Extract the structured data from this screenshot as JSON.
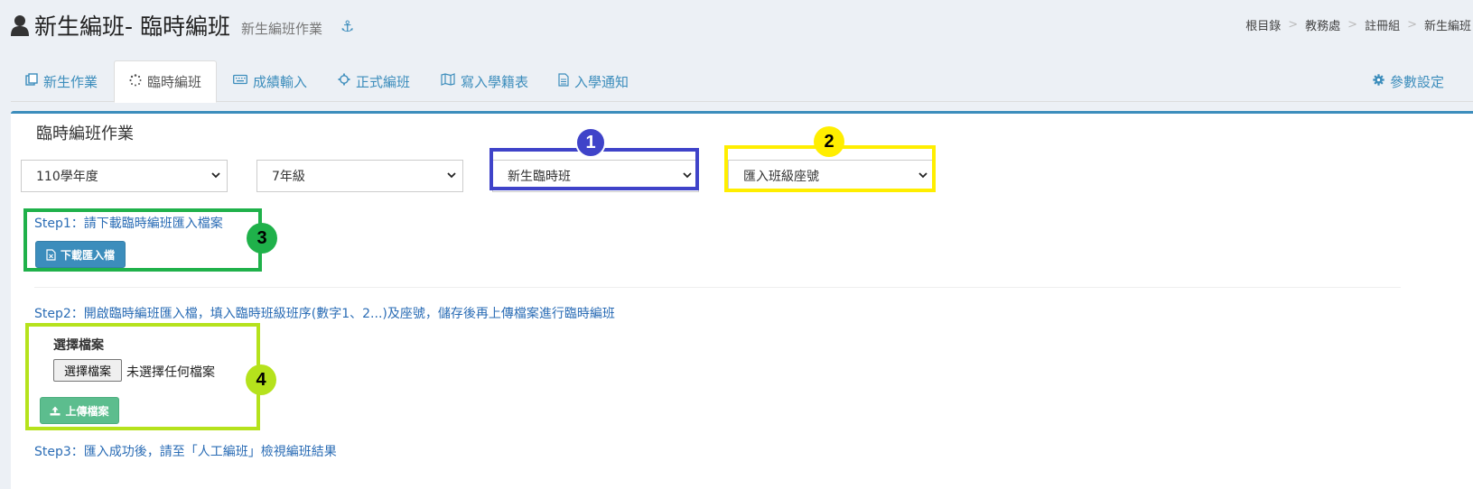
{
  "header": {
    "title": "新生編班- 臨時編班",
    "subtitle": "新生編班作業",
    "anchor_icon": "⚓"
  },
  "breadcrumb": [
    "根目錄",
    "教務處",
    "註冊組",
    "新生編班"
  ],
  "breadcrumb_sep": ">",
  "tabs": [
    {
      "label": "新生作業",
      "icon": "copy-icon"
    },
    {
      "label": "臨時編班",
      "icon": "spinner-icon"
    },
    {
      "label": "成績輸入",
      "icon": "keyboard-icon"
    },
    {
      "label": "正式編班",
      "icon": "gear-icon"
    },
    {
      "label": "寫入學籍表",
      "icon": "map-icon"
    },
    {
      "label": "入學通知",
      "icon": "file-icon"
    }
  ],
  "settings_label": "參數設定",
  "box": {
    "title": "臨時編班作業",
    "selects": [
      "110學年度",
      "7年級",
      "新生臨時班",
      "匯入班級座號"
    ],
    "step1": "Step1：請下載臨時編班匯入檔案",
    "download_button": "下載匯入檔",
    "step2": "Step2：開啟臨時編班匯入檔，填入臨時班級班序(數字1、2...)及座號，儲存後再上傳檔案進行臨時編班",
    "file_label": "選擇檔案",
    "file_button": "選擇檔案",
    "file_status": "未選擇任何檔案",
    "upload_button": "上傳檔案",
    "step3": "Step3：匯入成功後，請至「人工編班」檢視編班結果"
  },
  "annotations": [
    {
      "number": "1",
      "color": "#3f43c9",
      "badge_color": "#3f43c9",
      "text_color": "#ffffff"
    },
    {
      "number": "2",
      "color": "#ffee00",
      "badge_color": "#ffee00",
      "text_color": "#000000"
    },
    {
      "number": "3",
      "color": "#1fb14a",
      "badge_color": "#1fb14a",
      "text_color": "#000000"
    },
    {
      "number": "4",
      "color": "#b5e21c",
      "badge_color": "#b5e21c",
      "text_color": "#000000"
    }
  ],
  "colors": {
    "accent": "#3c8dbc",
    "link": "#2a6cb5",
    "upload": "#5cbd8e"
  }
}
